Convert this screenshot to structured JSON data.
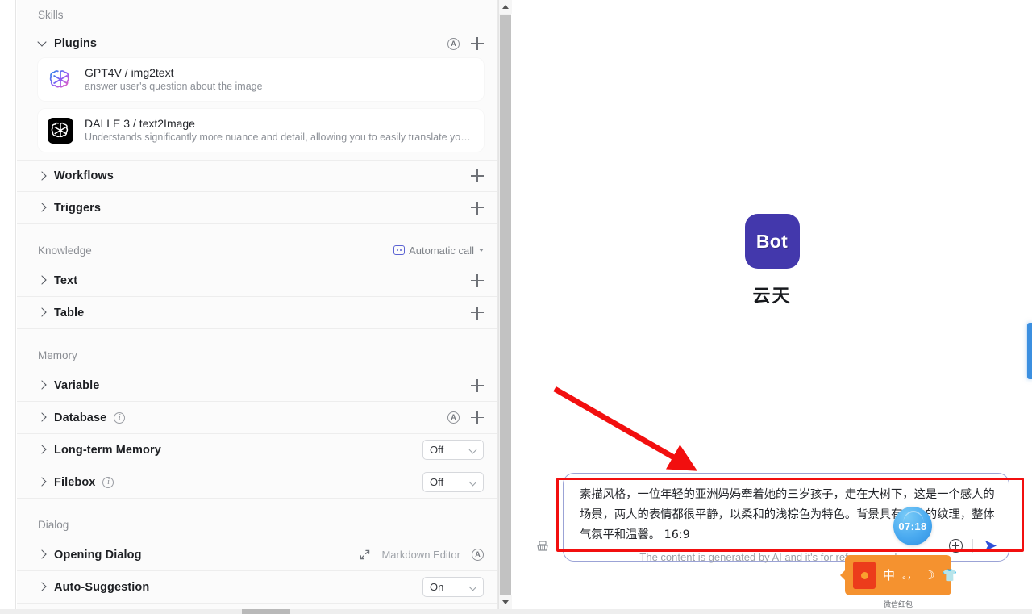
{
  "panel": {
    "sections": [
      {
        "id": "skills",
        "title": "Skills",
        "subgroup": {
          "label": "Plugins",
          "icons": [
            "circle-a-icon",
            "plus-icon"
          ]
        },
        "plugins": [
          {
            "name": "GPT4V / img2text",
            "desc": "answer user's question about the image",
            "icon": "openai-gradient-icon"
          },
          {
            "name": "DALLE 3 / text2Image",
            "desc": "Understands significantly more nuance and detail, allowing you to easily translate your id...",
            "icon": "openai-black-icon"
          }
        ],
        "rows": [
          {
            "label": "Workflows",
            "control": "plus"
          },
          {
            "label": "Triggers",
            "control": "plus"
          }
        ]
      },
      {
        "id": "knowledge",
        "title": "Knowledge",
        "header_control": {
          "label": "Automatic call",
          "icon": "automatic-call-icon"
        },
        "rows": [
          {
            "label": "Text",
            "control": "plus"
          },
          {
            "label": "Table",
            "control": "plus"
          }
        ]
      },
      {
        "id": "memory",
        "title": "Memory",
        "rows": [
          {
            "label": "Variable",
            "control": "plus"
          },
          {
            "label": "Database",
            "info": true,
            "control": "a-plus"
          },
          {
            "label": "Long-term Memory",
            "control": "select",
            "value": "Off"
          },
          {
            "label": "Filebox",
            "info": true,
            "control": "select",
            "value": "Off"
          }
        ]
      },
      {
        "id": "dialog",
        "title": "Dialog",
        "rows": [
          {
            "label": "Opening Dialog",
            "control": "markdown",
            "markdown_label": "Markdown Editor"
          },
          {
            "label": "Auto-Suggestion",
            "control": "select",
            "value": "On"
          }
        ]
      }
    ]
  },
  "chat": {
    "bot": {
      "avatar_label": "Bot",
      "name": "云天"
    },
    "composer": {
      "value": "素描风格，一位年轻的亚洲妈妈牽着她的三岁孩子，走在大树下，这是一个感人的场景，两人的表情都很平静，以柔和的浅棕色为特色。背景具有微妙的纹理，整体气氛平和温馨。 16:9",
      "send_icon": "send-arrow-icon",
      "attach_icon": "plus-circle-icon",
      "clear_icon": "broom-icon"
    },
    "disclaimer": "The content is generated by AI and it's for reference only.",
    "clock_widget": {
      "time": "07:18"
    },
    "ime": {
      "glyphs": [
        "中",
        "。，",
        "☽",
        "👕"
      ],
      "caption": "微信红包"
    }
  },
  "colors": {
    "accent": "#4338ac",
    "annotation_red": "#f20f0f",
    "ime_orange": "#f5922f",
    "send_blue": "#2f4fd8"
  }
}
